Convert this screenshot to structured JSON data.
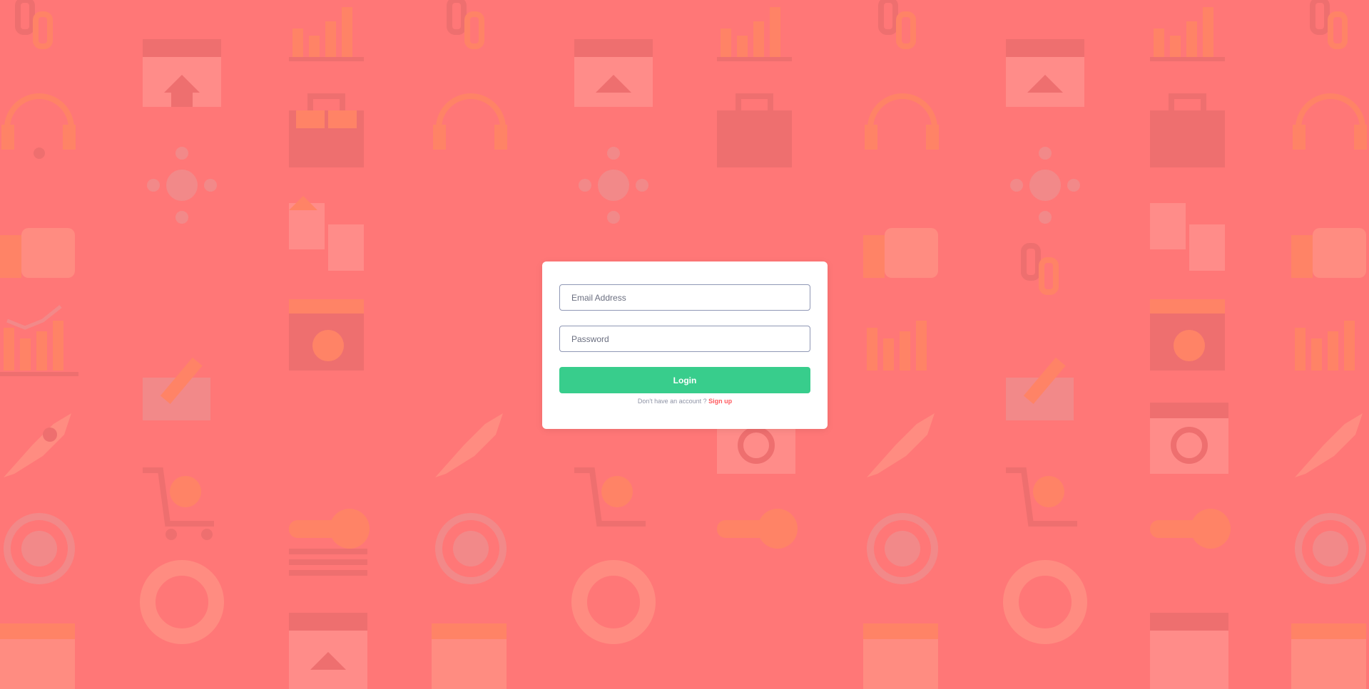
{
  "colors": {
    "background": "#ff7777",
    "card": "#ffffff",
    "login_button": "#38cd8c",
    "signup_link": "#ff5a5f",
    "field_border": "#8f97b5"
  },
  "background_pattern": {
    "icon_names": [
      "chain-link-icon",
      "browser-home-icon",
      "bar-chart-icon",
      "headset-icon",
      "toolbox-icon",
      "network-icon",
      "thumbs-up-icon",
      "file-sync-icon",
      "folder-gear-icon",
      "review-pencil-icon",
      "rocket-icon",
      "browser-search-icon",
      "shopping-cart-gear-icon",
      "key-icon",
      "globe-gear-icon",
      "lifebuoy-icon",
      "calendar-icon"
    ]
  },
  "login_form": {
    "email_placeholder": "Email Address",
    "password_placeholder": "Password",
    "email_value": "",
    "password_value": "",
    "login_label": "Login",
    "no_account_text": "Don't have an account ? ",
    "signup_label": "Sign up"
  }
}
